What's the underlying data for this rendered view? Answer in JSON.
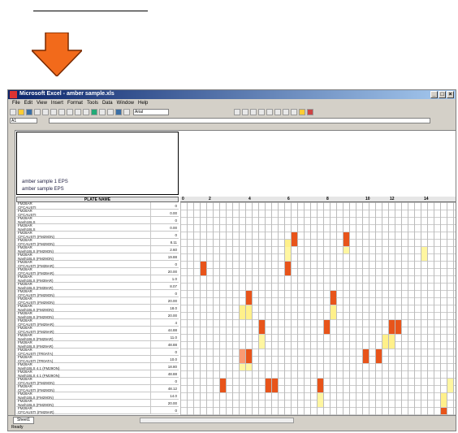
{
  "window": {
    "title": "Microsoft Excel - amber sample.xls",
    "controls": [
      "_",
      "□",
      "×"
    ]
  },
  "menu": [
    "File",
    "Edit",
    "View",
    "Insert",
    "Format",
    "Tools",
    "Data",
    "Window",
    "Help"
  ],
  "toolbar": {
    "font_box": "Arial"
  },
  "formula_bar": {
    "name_box": "A1"
  },
  "header_box": {
    "line1": "amber sample 1 EPS",
    "line2": "amber sample EPS"
  },
  "table": {
    "title": "PLATE NAME",
    "col_numbers": [
      "0",
      "2",
      "4",
      "6",
      "8",
      "10",
      "12",
      "14"
    ],
    "rows": [
      {
        "name": "FM28AR",
        "sub": "CFCAUSTI",
        "value": "0"
      },
      {
        "name": "FM28AR",
        "sub": "CFCAUSTI",
        "value": "0.00"
      },
      {
        "name": "FM28AR",
        "sub": "Nash1BLS",
        "value": "0"
      },
      {
        "name": "FM28AR",
        "sub": "Nash1BLS",
        "value": "0.00"
      },
      {
        "name": "FM28AR",
        "sub": "CFCAUSTI (FM29ON)",
        "value": "0"
      },
      {
        "name": "FM28AR",
        "sub": "CFCAUSTI (FM29ON)",
        "value": "8.11"
      },
      {
        "name": "FM28AR",
        "sub": "Nash1BLS (FM29ON)",
        "value": "2.60"
      },
      {
        "name": "FM28AR",
        "sub": "Nash1BLS (FM29ON)",
        "value": "19.88"
      },
      {
        "name": "FM28AR",
        "sub": "CFCAUSTI (FM39AR)",
        "value": "0"
      },
      {
        "name": "FM28AR",
        "sub": "CFCAUSTI (FM39AR)",
        "value": "20.00"
      },
      {
        "name": "FM28AR",
        "sub": "Nash1BLS (FM39AR)",
        "value": "1.0"
      },
      {
        "name": "FM28AR",
        "sub": "Nash1BLS (FM39AR)",
        "value": "8.07"
      },
      {
        "name": "FM28AR",
        "sub": "CFCAUSTI (FM29ON)",
        "value": "0"
      },
      {
        "name": "FM28AR",
        "sub": "CFCAUSTI (FM29ON)",
        "value": "20.00"
      },
      {
        "name": "FM28AR",
        "sub": "Nash1BLS (FM29ON)",
        "value": "18.0"
      },
      {
        "name": "FM28AR",
        "sub": "Nash1BLS (FM29ON)",
        "value": "20.00"
      },
      {
        "name": "FM28AR",
        "sub": "CFCAUSTI (FM29AR)",
        "value": "4"
      },
      {
        "name": "FM28AR",
        "sub": "CFCAUSTI (FM29AR)",
        "value": "44.88"
      },
      {
        "name": "FM28AR",
        "sub": "Nash1BLS (FM29AR)",
        "value": "11.0"
      },
      {
        "name": "FM28AR",
        "sub": "Nash1BLS (FM29AR)",
        "value": "48.88"
      },
      {
        "name": "FM28AR",
        "sub": "CFCAUSTI (TR0ATA)",
        "value": "0"
      },
      {
        "name": "FM28AR",
        "sub": "CFCAUSTI (TR0ATA)",
        "value": "10.0"
      },
      {
        "name": "FM28AR",
        "sub": "Nash1BLS 4.1 (FM29ON)",
        "value": "18.80"
      },
      {
        "name": "FM28AR",
        "sub": "Nash1BLS 4.1 (FM29ON)",
        "value": "48.88"
      },
      {
        "name": "FM28AR",
        "sub": "CFCAUSTI (FM29ON)",
        "value": "0"
      },
      {
        "name": "FM28AR",
        "sub": "CFCAUSTI (FM29ON)",
        "value": "48.12"
      },
      {
        "name": "FM28AR",
        "sub": "Nash1BLS (FM29ON)",
        "value": "14.0"
      },
      {
        "name": "FM28AR",
        "sub": "Nash1BLS (FM29ON)",
        "value": "20.00"
      },
      {
        "name": "FM28AR",
        "sub": "CFCAUSTI (FM29AR)",
        "value": "0"
      }
    ]
  },
  "heatmap_cells": [
    {
      "row": 8,
      "col": 3,
      "h": 2,
      "color": "#e8541a"
    },
    {
      "row": 8,
      "col": 16,
      "h": 2,
      "color": "#e8541a"
    },
    {
      "row": 4,
      "col": 17,
      "h": 2,
      "color": "#e8541a"
    },
    {
      "row": 5,
      "col": 16,
      "h": 2,
      "color": "#fff08a"
    },
    {
      "row": 6,
      "col": 16,
      "h": 2,
      "color": "#fff6a0"
    },
    {
      "row": 4,
      "col": 25,
      "h": 2,
      "color": "#e8541a"
    },
    {
      "row": 6,
      "col": 25,
      "h": 1,
      "color": "#fff6a0"
    },
    {
      "row": 6,
      "col": 37,
      "h": 2,
      "color": "#fff6a0"
    },
    {
      "row": 12,
      "col": 10,
      "h": 2,
      "color": "#e8541a"
    },
    {
      "row": 14,
      "col": 9,
      "h": 2,
      "color": "#fff08a"
    },
    {
      "row": 14,
      "col": 10,
      "h": 2,
      "color": "#fff08a"
    },
    {
      "row": 12,
      "col": 23,
      "h": 2,
      "color": "#e8541a"
    },
    {
      "row": 14,
      "col": 23,
      "h": 2,
      "color": "#fff08a"
    },
    {
      "row": 16,
      "col": 12,
      "h": 2,
      "color": "#e8541a"
    },
    {
      "row": 18,
      "col": 12,
      "h": 2,
      "color": "#fff6a0"
    },
    {
      "row": 16,
      "col": 22,
      "h": 2,
      "color": "#e8541a"
    },
    {
      "row": 16,
      "col": 32,
      "h": 2,
      "color": "#e8541a"
    },
    {
      "row": 16,
      "col": 33,
      "h": 2,
      "color": "#e8541a"
    },
    {
      "row": 18,
      "col": 31,
      "h": 2,
      "color": "#fff08a"
    },
    {
      "row": 18,
      "col": 32,
      "h": 2,
      "color": "#fff08a"
    },
    {
      "row": 20,
      "col": 9,
      "h": 2,
      "color": "#fa9a73"
    },
    {
      "row": 20,
      "col": 10,
      "h": 2,
      "color": "#e8541a"
    },
    {
      "row": 22,
      "col": 9,
      "h": 1,
      "color": "#fff6a0"
    },
    {
      "row": 22,
      "col": 10,
      "h": 1,
      "color": "#fff6a0"
    },
    {
      "row": 20,
      "col": 28,
      "h": 2,
      "color": "#e8541a"
    },
    {
      "row": 20,
      "col": 30,
      "h": 2,
      "color": "#e8541a"
    },
    {
      "row": 24,
      "col": 6,
      "h": 2,
      "color": "#e8541a"
    },
    {
      "row": 24,
      "col": 13,
      "h": 2,
      "color": "#e8541a"
    },
    {
      "row": 24,
      "col": 14,
      "h": 2,
      "color": "#e8541a"
    },
    {
      "row": 24,
      "col": 21,
      "h": 2,
      "color": "#e8541a"
    },
    {
      "row": 26,
      "col": 21,
      "h": 2,
      "color": "#fff6a0"
    },
    {
      "row": 26,
      "col": 40,
      "h": 2,
      "color": "#fff08a"
    },
    {
      "row": 28,
      "col": 40,
      "h": 1,
      "color": "#e8541a"
    },
    {
      "row": 24,
      "col": 41,
      "h": 2,
      "color": "#fff6a0"
    }
  ],
  "sheet_tabs": [
    "Sheet1"
  ],
  "status": "Ready",
  "colors": {
    "arrow": "#f26a1b",
    "hot": "#e8541a",
    "warm": "#fff08a"
  }
}
